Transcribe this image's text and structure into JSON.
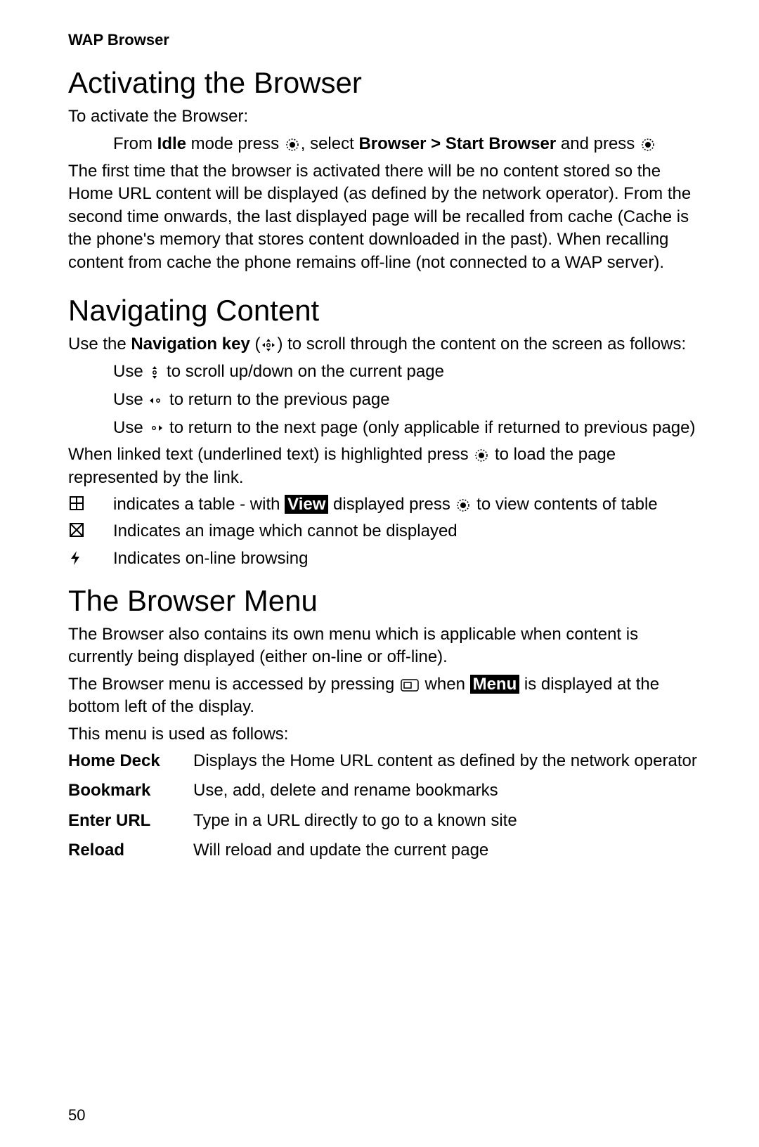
{
  "header": "WAP Browser",
  "page_number": "50",
  "section1": {
    "title": "Activating the Browser",
    "intro": "To activate the Browser:",
    "step_a": "From ",
    "step_idle": "Idle",
    "step_b": " mode press ",
    "step_c": ", select ",
    "step_nav": "Browser > Start Browser",
    "step_d": " and press ",
    "body": "The first time that the browser is activated there will be no content stored so the Home URL content will be displayed (as defined by the network operator). From the second time onwards, the last displayed page will be recalled from cache (Cache is the phone's memory that stores content downloaded in the past). When recalling content from cache the phone remains off-line (not connected to a WAP server)."
  },
  "section2": {
    "title": "Navigating Content",
    "p1_a": "Use the ",
    "p1_navkey": "Navigation key",
    "p1_b": " (",
    "p1_c": ") to scroll through the content on the screen as follows:",
    "b1_a": "Use ",
    "b1_b": " to scroll up/down on the current page",
    "b2_a": "Use ",
    "b2_b": " to return to the previous page",
    "b3_a": "Use ",
    "b3_b": " to return to the next page (only applicable if returned to previous page)",
    "p2_a": "When linked text (underlined text) is highlighted press ",
    "p2_b": " to load the page represented by the link.",
    "t1_a": "indicates a table - with ",
    "t1_view": "View",
    "t1_b": " displayed press ",
    "t1_c": " to view contents of table",
    "t2": "Indicates an image which cannot be displayed",
    "t3": "Indicates on-line browsing"
  },
  "section3": {
    "title": "The Browser Menu",
    "p1": "The Browser also contains its own menu which is applicable when content is currently being displayed (either on-line or off-line).",
    "p2_a": "The Browser menu is accessed by pressing ",
    "p2_b": " when ",
    "p2_menu": "Menu",
    "p2_c": " is displayed at the bottom left of the display.",
    "p3": "This menu is used as follows:",
    "rows": {
      "r1l": "Home Deck",
      "r1t": "Displays the Home URL content as defined by the network operator",
      "r2l": "Bookmark",
      "r2t": "Use, add, delete and rename bookmarks",
      "r3l": "Enter URL",
      "r3t": "Type in a URL directly to go to a known site",
      "r4l": "Reload",
      "r4t": "Will reload and update the current page"
    }
  }
}
